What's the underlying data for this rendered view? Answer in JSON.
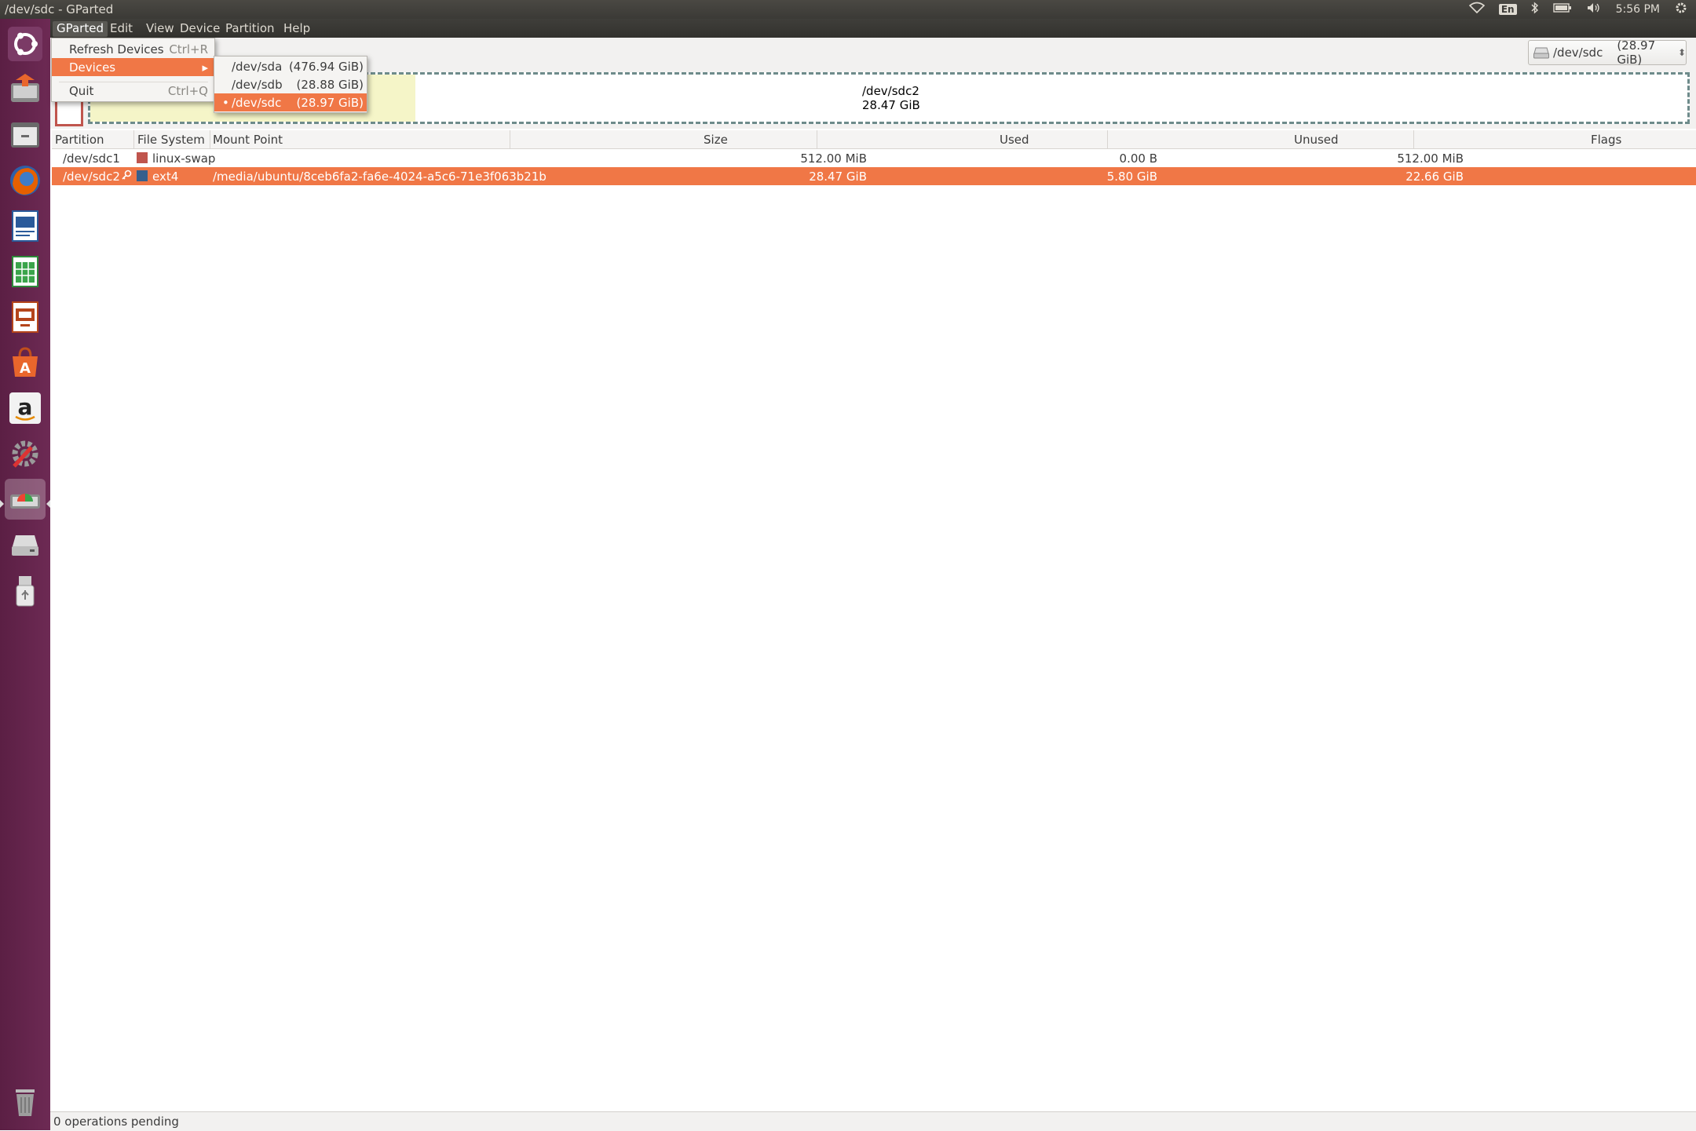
{
  "window": {
    "title": "/dev/sdc - GParted"
  },
  "top_panel": {
    "lang": "En",
    "time": "5:56 PM"
  },
  "launcher": {
    "items": [
      "ubuntu-dash-icon",
      "files-installer-icon",
      "file-manager-icon",
      "firefox-icon",
      "writer-icon",
      "calc-icon",
      "impress-icon",
      "software-center-icon",
      "amazon-icon",
      "system-settings-icon",
      "gparted-icon",
      "disk-icon",
      "usb-drive-icon",
      "trash-icon"
    ]
  },
  "menubar": {
    "items": [
      "GParted",
      "Edit",
      "View",
      "Device",
      "Partition",
      "Help"
    ]
  },
  "gparted_menu": {
    "refresh": {
      "label": "Refresh Devices",
      "accel": "Ctrl+R"
    },
    "devices": {
      "label": "Devices",
      "arrow": "▸"
    },
    "quit": {
      "label": "Quit",
      "accel": "Ctrl+Q"
    }
  },
  "devices_menu": [
    {
      "name": "/dev/sda",
      "size": "(476.94 GiB)"
    },
    {
      "name": "/dev/sdb",
      "size": "(28.88 GiB)"
    },
    {
      "name": "/dev/sdc",
      "size": "(28.97 GiB)",
      "selected_marker": "•"
    }
  ],
  "device_combo": {
    "name": "/dev/sdc",
    "size": "(28.97 GiB)",
    "arrow": "⬍"
  },
  "graphic": {
    "partition_name": "/dev/sdc2",
    "partition_size": "28.47 GiB"
  },
  "table": {
    "headers": [
      "Partition",
      "File System",
      "Mount Point",
      "Size",
      "Used",
      "Unused",
      "Flags"
    ],
    "rows": [
      {
        "partition": "/dev/sdc1",
        "fs": "linux-swap",
        "fs_color": "#c0554d",
        "mount": "",
        "size": "512.00 MiB",
        "used": "0.00 B",
        "unused": "512.00 MiB",
        "flags": ""
      },
      {
        "partition": "/dev/sdc2",
        "fs": "ext4",
        "fs_color": "#385f8c",
        "mount": "/media/ubuntu/8ceb6fa2-fa6e-4024-a5c6-71e3f063b21b",
        "size": "28.47 GiB",
        "used": "5.80 GiB",
        "unused": "22.66 GiB",
        "flags": ""
      }
    ]
  },
  "status": {
    "text": "0 operations pending"
  }
}
